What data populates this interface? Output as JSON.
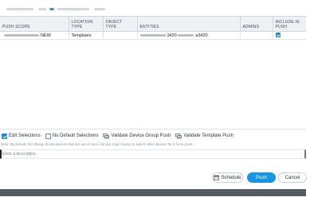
{
  "table": {
    "columns": [
      {
        "label": "PUSH SCOPE"
      },
      {
        "label": "LOCATION TYPE"
      },
      {
        "label": "OBJECT TYPE"
      },
      {
        "label": "ENTITIES"
      },
      {
        "label": "ADMINS"
      },
      {
        "label": "INCLUDE IN PUSH"
      }
    ],
    "rows": [
      {
        "scope_suffix": "NEW",
        "location_type": "Templates",
        "object_type": "",
        "entities_a": "3420",
        "entities_b": "a3420",
        "admins": "",
        "include": true
      }
    ]
  },
  "toolbar": {
    "edit_selections": {
      "label": "Edit Selections",
      "checked": true
    },
    "no_default_selections": {
      "label": "No Default Selections",
      "checked": false
    },
    "validate_device_group_push": "Validate Device Group Push",
    "validate_template_push": "Validate Template Push"
  },
  "note": "Note: By default, this dialog shows devices that are out of sync. Admins may choose to select other devices for a force push.",
  "description": {
    "placeholder": "Enter a description",
    "value": ""
  },
  "buttons": {
    "schedule": "Schedule",
    "push": "Push",
    "cancel": "Cancel"
  },
  "colors": {
    "accent": "#1996e3",
    "checkbox": "#1e88d9",
    "footer": "#575c61"
  }
}
